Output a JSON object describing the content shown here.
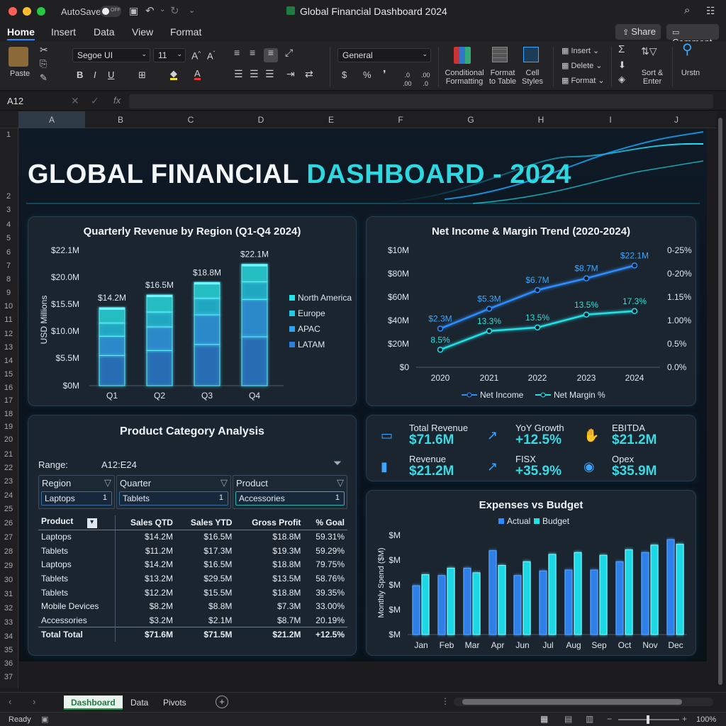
{
  "titlebar": {
    "autosave": "AutoSave",
    "toggle": "OFF",
    "title": "Global Financial Dashboard 2024"
  },
  "menu": {
    "tabs": [
      "Home",
      "Insert",
      "Data",
      "View",
      "Format"
    ],
    "share": "Share",
    "comment": "Comment"
  },
  "ribbon": {
    "paste": "Paste",
    "font": "Segoe UI",
    "size": "11",
    "numfmt": "General",
    "cond": "Conditional Formatting",
    "fmt_table": "Format to Table",
    "cell_styles": "Cell Styles",
    "insert": "Insert",
    "delete": "Delete",
    "format": "Format",
    "sort": "Sort & Enter",
    "search": "Urstn"
  },
  "formula": {
    "namebox": "A12",
    "fx": "fx"
  },
  "columns": [
    "A",
    "B",
    "C",
    "D",
    "E",
    "F",
    "G",
    "H",
    "I",
    "J"
  ],
  "rows": [
    "1",
    "2",
    "3",
    "4",
    "5",
    "6",
    "7",
    "8",
    "9",
    "10",
    "11",
    "12",
    "13",
    "14",
    "15",
    "16",
    "17",
    "18",
    "19",
    "20",
    "21",
    "22",
    "23",
    "24",
    "25",
    "26",
    "27",
    "28",
    "29",
    "30",
    "31",
    "32",
    "33",
    "34",
    "35",
    "36",
    "37"
  ],
  "dashboard": {
    "title_a": "GLOBAL FINANCIAL ",
    "title_b": "DASHBOARD - 2024"
  },
  "chart1": {
    "title": "Quarterly Revenue by Region (Q1-Q4 2024)",
    "ylabel": "USD Millions",
    "yticks": [
      "$22.1M",
      "$20.0M",
      "$15.5M",
      "$10.0M",
      "$5.5M",
      "$0M"
    ],
    "categories": [
      "Q1",
      "Q2",
      "Q3",
      "Q4"
    ],
    "labels": [
      "$14.2M",
      "$16.5M",
      "$18.8M",
      "$22.1M"
    ],
    "legend": [
      "North America",
      "Europe",
      "APAC",
      "LATAM"
    ]
  },
  "chart2": {
    "title": "Net Income & Margin Trend (2020-2024)",
    "yticks_left": [
      "$10M",
      "$80M",
      "$60M",
      "$40M",
      "$20M",
      "$0"
    ],
    "yticks_right": [
      "0-25%",
      "0-20%",
      "1.15%",
      "1.00%",
      "0.5%",
      "0.0%"
    ],
    "years": [
      "2020",
      "2021",
      "2022",
      "2023",
      "2024"
    ],
    "income_labels": [
      "$2.3M",
      "$5.3M",
      "$6.7M",
      "$8.7M",
      "$22.1M"
    ],
    "margin_labels": [
      "8.5%",
      "13.3%",
      "13.5%",
      "13.5%",
      "17.3%"
    ],
    "legend": [
      "Net Income",
      "Net Margin %"
    ]
  },
  "kpis": [
    {
      "label": "Total Revenue",
      "value": "$71.6M",
      "icon": "money-icon"
    },
    {
      "label": "YoY Growth",
      "value": "+12.5%",
      "icon": "trend-icon"
    },
    {
      "label": "EBITDA",
      "value": "$21.2M",
      "icon": "hand-coin-icon"
    },
    {
      "label": "Revenue",
      "value": "$21.2M",
      "icon": "bar-icon"
    },
    {
      "label": "FISX",
      "value": "+35.9%",
      "icon": "growth-icon"
    },
    {
      "label": "Opex",
      "value": "$35.9M",
      "icon": "coins-icon"
    }
  ],
  "product": {
    "title": "Product Category Analysis",
    "range_label": "Range:",
    "range_value": "A12:E24",
    "slicers": [
      {
        "label": "Region",
        "item": "Laptops",
        "count": "1"
      },
      {
        "label": "Quarter",
        "item": "Tablets",
        "count": "1"
      },
      {
        "label": "Product",
        "item": "Accessories",
        "count": "1"
      }
    ],
    "headers": [
      "Product",
      "Sales QTD",
      "Sales YTD",
      "Gross Profit",
      "% Goal"
    ],
    "rows": [
      [
        "Laptops",
        "$14.2M",
        "$16.5M",
        "$18.8M",
        "59.31%"
      ],
      [
        "Tablets",
        "$11.2M",
        "$17.3M",
        "$19.3M",
        "59.29%"
      ],
      [
        "Laptops",
        "$14.2M",
        "$16.5M",
        "$18.8M",
        "79.75%"
      ],
      [
        "Tablets",
        "$13.2M",
        "$29.5M",
        "$13.5M",
        "58.76%"
      ],
      [
        "Tablets",
        "$12.2M",
        "$15.5M",
        "$18.8M",
        "39.35%"
      ],
      [
        "Mobile Devices",
        "$8.2M",
        "$8.8M",
        "$7.3M",
        "33.00%"
      ],
      [
        "Accessories",
        "$3.2M",
        "$2.1M",
        "$8.7M",
        "20.19%"
      ]
    ],
    "total": [
      "Total Total",
      "$71.6M",
      "$71.5M",
      "$21.2M",
      "+12.5%"
    ]
  },
  "chart3": {
    "title": "Expenses vs Budget",
    "legend": [
      "Actual",
      "Budget"
    ],
    "ylabel": "Monthly Spend ($M)",
    "yticks": [
      "$M",
      "$M",
      "$M",
      "$M",
      "$M"
    ],
    "months": [
      "Jan",
      "Feb",
      "Mar",
      "Apr",
      "Jun",
      "Jul",
      "Aug",
      "Sep",
      "Oct",
      "Nov",
      "Dec"
    ]
  },
  "tabs": [
    "Dashboard",
    "Data",
    "Pivots"
  ],
  "status": {
    "ready": "Ready",
    "zoom": "100%"
  },
  "chart_data": [
    {
      "type": "bar",
      "title": "Quarterly Revenue by Region (Q1-Q4 2024)",
      "categories": [
        "Q1",
        "Q2",
        "Q3",
        "Q4"
      ],
      "series": [
        {
          "name": "LATAM",
          "values": [
            5.5,
            6.4,
            7.5,
            8.9
          ]
        },
        {
          "name": "APAC",
          "values": [
            3.5,
            4.3,
            5.4,
            6.8
          ]
        },
        {
          "name": "Europe",
          "values": [
            2.4,
            2.7,
            3.0,
            3.2
          ]
        },
        {
          "name": "North America",
          "values": [
            2.8,
            3.1,
            2.9,
            3.2
          ]
        }
      ],
      "totals": [
        14.2,
        16.5,
        18.8,
        22.1
      ],
      "ylabel": "USD Millions",
      "ylim": [
        0,
        24
      ]
    },
    {
      "type": "line",
      "title": "Net Income & Margin Trend (2020-2024)",
      "x": [
        "2020",
        "2021",
        "2022",
        "2023",
        "2024"
      ],
      "series": [
        {
          "name": "Net Income",
          "values": [
            33,
            50,
            66,
            76,
            87
          ]
        },
        {
          "name": "Net Margin %",
          "values": [
            15,
            31,
            34,
            45,
            48
          ]
        }
      ],
      "ylim": [
        0,
        100
      ]
    },
    {
      "type": "bar",
      "title": "Expenses vs Budget",
      "categories": [
        "Jan",
        "Feb",
        "Mar",
        "Apr",
        "Jun",
        "Jul",
        "Aug",
        "Sep",
        "Oct",
        "Nov",
        "Dec"
      ],
      "series": [
        {
          "name": "Actual",
          "values": [
            5.3,
            6.4,
            7.2,
            9.1,
            6.4,
            6.9,
            7.0,
            7.0,
            7.9,
            8.9,
            10.3
          ]
        },
        {
          "name": "Budget",
          "values": [
            6.5,
            7.2,
            6.7,
            7.5,
            7.9,
            8.7,
            8.9,
            8.6,
            9.2,
            9.7,
            9.8
          ]
        }
      ],
      "ylabel": "Monthly Spend ($M)",
      "ylim": [
        0,
        11
      ]
    }
  ],
  "colors": {
    "accent": "#39d9e6",
    "blue": "#2f8cff",
    "cyan": "#21e0e6",
    "panel": "#1a2530"
  }
}
